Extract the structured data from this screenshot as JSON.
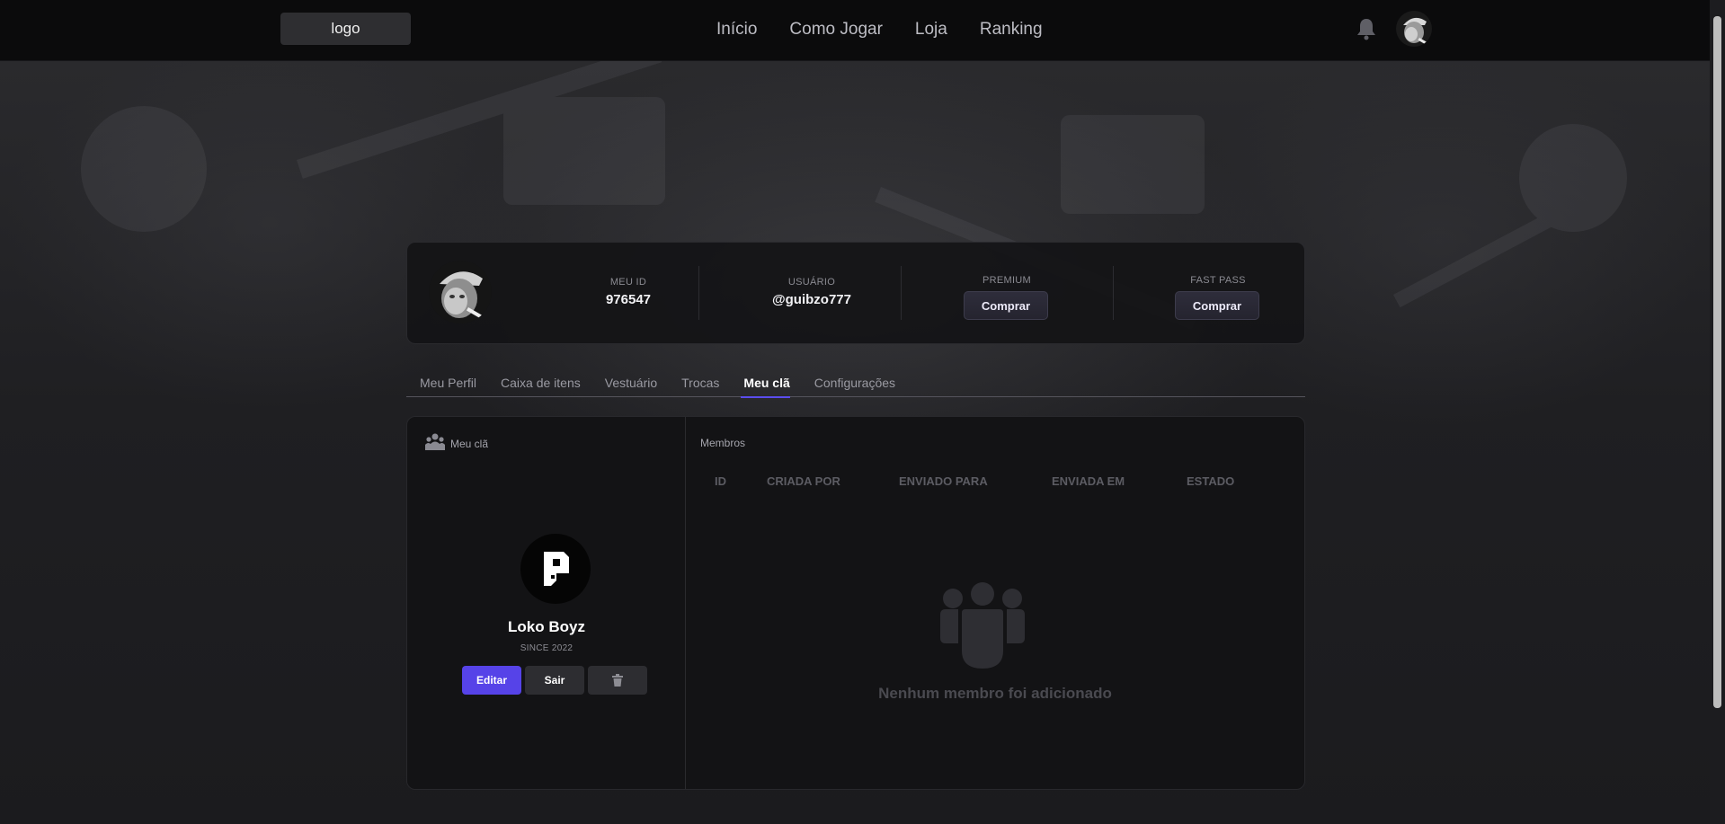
{
  "header": {
    "logo": "logo",
    "nav": [
      "Início",
      "Como Jogar",
      "Loja",
      "Ranking"
    ]
  },
  "profile": {
    "id_label": "MEU ID",
    "id_value": "976547",
    "user_label": "USUÁRIO",
    "user_value": "@guibzo777",
    "premium_label": "PREMIUM",
    "premium_button": "Comprar",
    "fastpass_label": "FAST PASS",
    "fastpass_button": "Comprar"
  },
  "tabs": [
    "Meu Perfil",
    "Caixa de itens",
    "Vestuário",
    "Trocas",
    "Meu clã",
    "Configurações"
  ],
  "active_tab": "Meu clã",
  "clan": {
    "title": "Meu clã",
    "name": "Loko Boyz",
    "since": "SINCE 2022",
    "edit_button": "Editar",
    "leave_button": "Sair"
  },
  "members": {
    "title": "Membros",
    "columns": [
      "ID",
      "CRIADA POR",
      "ENVIADO PARA",
      "ENVIADA EM",
      "ESTADO"
    ],
    "rows": [],
    "empty_text": "Nenhum membro foi adicionado"
  },
  "colors": {
    "accent": "#5643e8",
    "header_bg": "#0b0b0c",
    "card_bg": "#131315"
  }
}
